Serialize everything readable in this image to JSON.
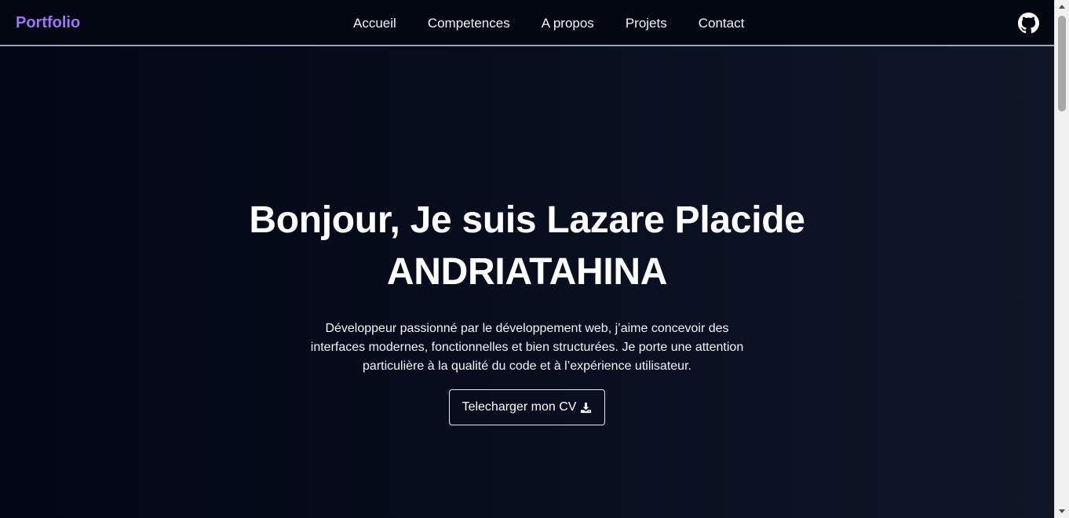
{
  "navbar": {
    "brand": "Portfolio",
    "links": [
      "Accueil",
      "Competences",
      "A propos",
      "Projets",
      "Contact"
    ],
    "github_icon": "github-icon"
  },
  "hero": {
    "title_line1": "Bonjour, Je suis Lazare Placide",
    "title_line2": "ANDRIATAHINA",
    "description": "Développeur passionné par le développement web, j’aime concevoir des interfaces modernes, fonctionnelles et bien structurées. Je porte une attention particulière à la qualité du code et à l’expérience utilisateur.",
    "cv_button_label": "Telecharger mon CV",
    "cv_button_icon": "download-icon"
  },
  "colors": {
    "brand": "#a371f7",
    "background": "#0b1120",
    "navbar_bg": "#030712",
    "text": "#ffffff"
  }
}
